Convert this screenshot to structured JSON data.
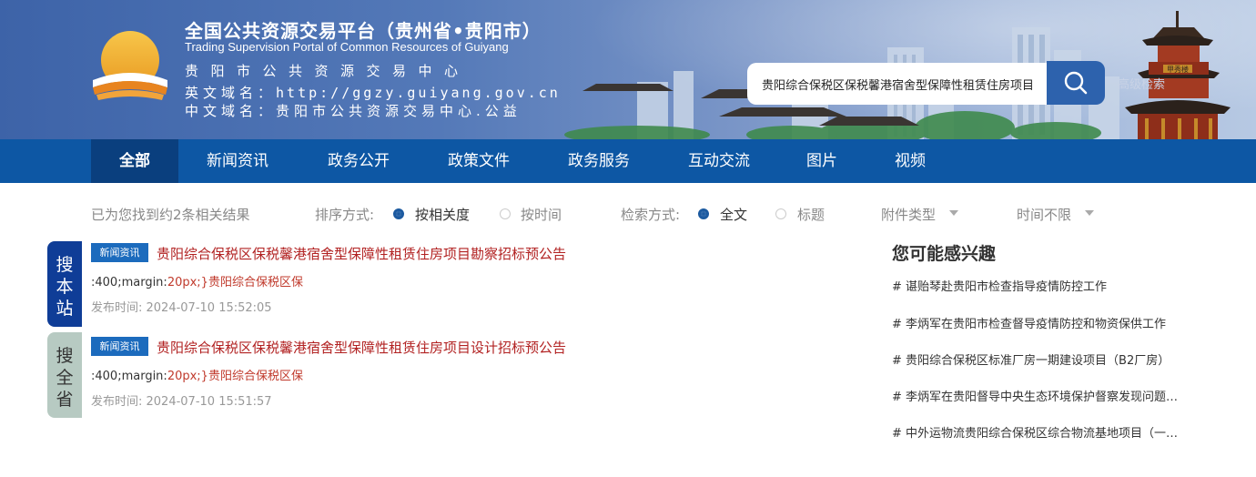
{
  "header": {
    "title_cn": "全国公共资源交易平台（贵州省•贵阳市）",
    "title_en": "Trading Supervision Portal of Common Resources of Guiyang",
    "center_name": "贵阳市公共资源交易中心",
    "en_domain_label": "英文域名：",
    "en_domain_value": "http://ggzy.guiyang.gov.cn",
    "cn_domain_label": "中文域名：",
    "cn_domain_value": "贵阳市公共资源交易中心.公益",
    "pavilion_sign": "甲秀楼"
  },
  "search": {
    "value": "贵阳综合保税区保税馨港宿舍型保障性租赁住房项目勘察招标预公告",
    "button_icon": "search-icon",
    "advanced_label": "高级检索"
  },
  "nav": {
    "items": [
      "全部",
      "新闻资讯",
      "政务公开",
      "政策文件",
      "政务服务",
      "互动交流",
      "图片",
      "视频"
    ],
    "active_index": 0
  },
  "filters": {
    "result_count_text": "已为您找到约2条相关结果",
    "sort_label": "排序方式:",
    "sort_options": [
      "按相关度",
      "按时间"
    ],
    "sort_selected": 0,
    "search_mode_label": "检索方式:",
    "search_mode_options": [
      "全文",
      "标题"
    ],
    "search_mode_selected": 0,
    "attachment_type": "附件类型",
    "time_range": "时间不限"
  },
  "side_tabs": {
    "local": "搜本站",
    "province": "搜全省"
  },
  "results": [
    {
      "badge": "新闻资讯",
      "title": "贵阳综合保税区保税馨港宿舍型保障性租赁住房项目勘察招标预公告",
      "snippet_prefix": ":400;margin:",
      "snippet_highlight": "20px;}贵阳综合保税区保",
      "pub_time": "发布时间:  2024-07-10 15:52:05"
    },
    {
      "badge": "新闻资讯",
      "title": "贵阳综合保税区保税馨港宿舍型保障性租赁住房项目设计招标预公告",
      "snippet_prefix": ":400;margin:",
      "snippet_highlight": "20px;}贵阳综合保税区保",
      "pub_time": "发布时间:  2024-07-10 15:51:57"
    }
  ],
  "recommend": {
    "title": "您可能感兴趣",
    "items": [
      "# 谌贻琴赴贵阳市检查指导疫情防控工作",
      "# 李炳军在贵阳市检查督导疫情防控和物资保供工作",
      "# 贵阳综合保税区标准厂房一期建设项目（B2厂房）",
      "# 李炳军在贵阳督导中央生态环境保护督察发现问题整改",
      "# 中外运物流贵阳综合保税区综合物流基地项目（一期）"
    ]
  },
  "colors": {
    "nav_bg": "#0d57a4",
    "nav_active": "#0a3f7e",
    "title_red": "#b22222",
    "badge_blue": "#1c6bbd",
    "tab_local": "#0f3d97",
    "tab_province": "#b7cac2"
  }
}
